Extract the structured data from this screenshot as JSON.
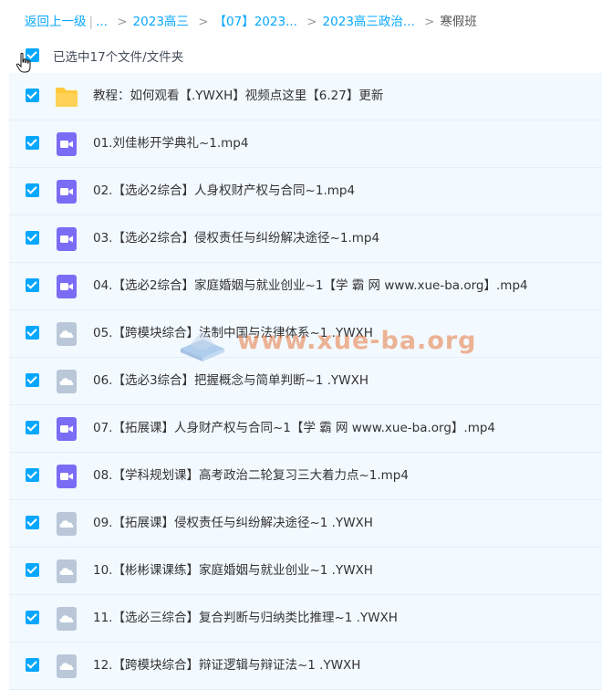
{
  "breadcrumb": {
    "back": "返回上一级",
    "ellipsis": "...",
    "items": [
      "2023高三",
      "【07】2023...",
      "2023高三政治..."
    ],
    "current": "寒假班"
  },
  "selection": {
    "label": "已选中17个文件/文件夹"
  },
  "files": [
    {
      "name": "教程：如何观看【.YWXH】视频点这里【6.27】更新",
      "type": "folder-icon"
    },
    {
      "name": "01.刘佳彬开学典礼~1.mp4",
      "type": "video-icon"
    },
    {
      "name": "02.【选必2综合】人身权财产权与合同~1.mp4",
      "type": "video-icon"
    },
    {
      "name": "03.【选必2综合】侵权责任与纠纷解决途径~1.mp4",
      "type": "video-icon"
    },
    {
      "name": "04.【选必2综合】家庭婚姻与就业创业~1【学 霸 网 www.xue-ba.org】.mp4",
      "type": "video-icon"
    },
    {
      "name": "05.【跨模块综合】法制中国与法律体系~1 .YWXH",
      "type": "cloud-icon"
    },
    {
      "name": "06.【选必3综合】把握概念与简单判断~1 .YWXH",
      "type": "cloud-icon"
    },
    {
      "name": "07.【拓展课】人身财产权与合同~1【学 霸 网 www.xue-ba.org】.mp4",
      "type": "video-icon"
    },
    {
      "name": "08.【学科规划课】高考政治二轮复习三大着力点~1.mp4",
      "type": "video-icon"
    },
    {
      "name": "09.【拓展课】侵权责任与纠纷解决途径~1 .YWXH",
      "type": "cloud-icon"
    },
    {
      "name": "10.【彬彬课课练】家庭婚姻与就业创业~1 .YWXH",
      "type": "cloud-icon"
    },
    {
      "name": "11.【选必三综合】复合判断与归纳类比推理~1 .YWXH",
      "type": "cloud-icon"
    },
    {
      "name": "12.【跨模块综合】辩证逻辑与辩证法~1 .YWXH",
      "type": "cloud-icon"
    }
  ],
  "watermark": {
    "text": "www.xue-ba.org"
  },
  "colors": {
    "accent": "#06a7ff",
    "video": "#7b6cf6",
    "folder": "#ffc83d",
    "cloud": "#b9c7d8",
    "row_bg": "#f2f9ff"
  }
}
